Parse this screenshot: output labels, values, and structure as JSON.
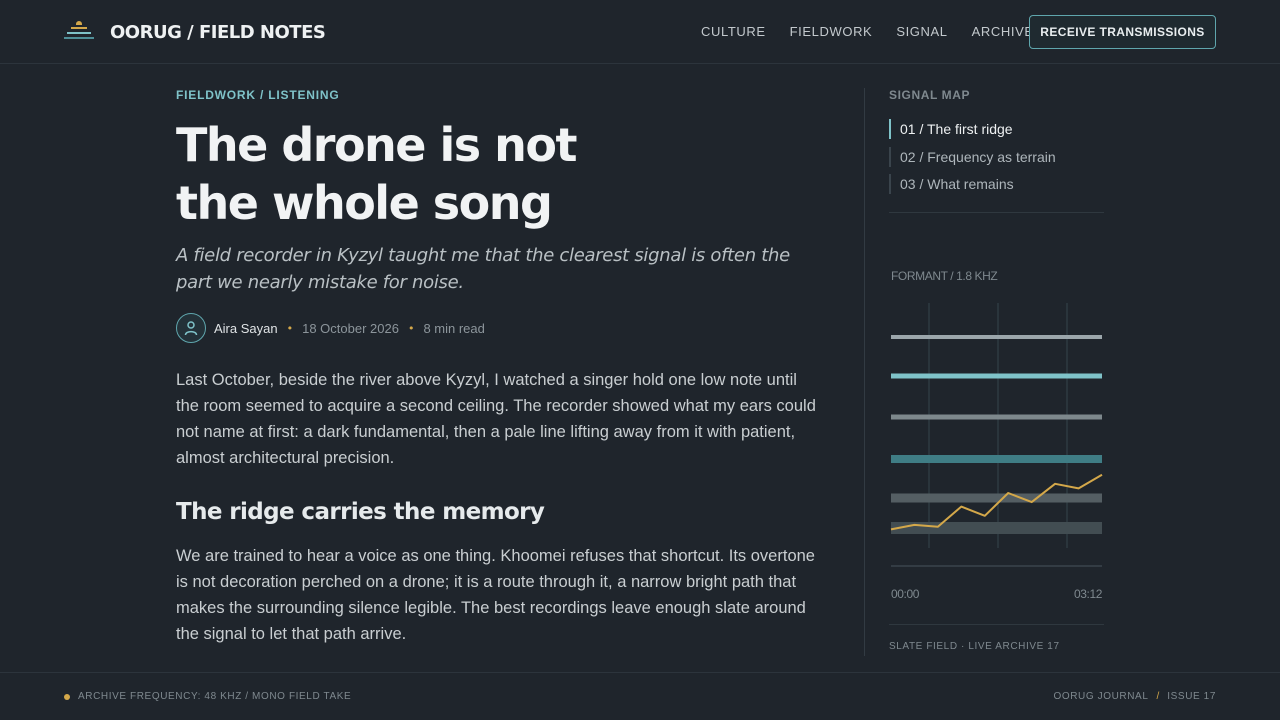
{
  "header": {
    "brand": "OORUG / FIELD NOTES",
    "nav": [
      "CULTURE",
      "FIELDWORK",
      "SIGNAL",
      "ARCHIVE"
    ],
    "cta": "RECEIVE TRANSMISSIONS",
    "icon": "stacked-waves-logo"
  },
  "article": {
    "kicker": "FIELDWORK / LISTENING",
    "title_line1": "The drone is not",
    "title_line2": "the whole song",
    "dek": "A field recorder in Kyzyl taught me that the clearest signal is often the part we nearly mistake for noise.",
    "author": "Aira Sayan",
    "date": "18 October 2026",
    "read_time": "8 min read",
    "paragraph1": "Last October, beside the river above Kyzyl, I watched a singer hold one low note until the room seemed to acquire a second ceiling. The recorder showed what my ears could not name at first: a dark fundamental, then a pale line lifting away from it with patient, almost architectural precision.",
    "subhead": "The ridge carries the memory",
    "paragraph2": "We are trained to hear a voice as one thing. Khoomei refuses that shortcut. Its overtone is not decoration perched on a drone; it is a route through it, a narrow bright path that makes the surrounding silence legible. The best recordings leave enough slate around the signal to let that path arrive."
  },
  "sidebar": {
    "title": "SIGNAL MAP",
    "toc": [
      "01 / The first ridge",
      "02 / Frequency as terrain",
      "03 / What remains"
    ],
    "active_index": 0,
    "footer": "SLATE FIELD · LIVE ARCHIVE 17"
  },
  "chart_data": {
    "type": "line",
    "title": "FORMANT / 1.8 KHZ",
    "x_tick_labels": [
      "00:00",
      "03:12"
    ],
    "bands": [
      {
        "color": "#9ba6ab"
      },
      {
        "color": "#7fc3c9"
      },
      {
        "color": "#7d888c"
      },
      {
        "color": "#3f7d85"
      },
      {
        "color": "#545e63"
      },
      {
        "color": "#424d52"
      }
    ],
    "series": [
      {
        "color": "#d4a84a",
        "values": [
          0.05,
          0.1,
          0.08,
          0.3,
          0.2,
          0.45,
          0.35,
          0.55,
          0.5,
          0.65
        ]
      }
    ],
    "grid": true
  },
  "footer": {
    "left": "ARCHIVE FREQUENCY: 48 KHZ / MONO FIELD TAKE",
    "right_a": "OORUG JOURNAL",
    "right_b": "ISSUE 17"
  }
}
